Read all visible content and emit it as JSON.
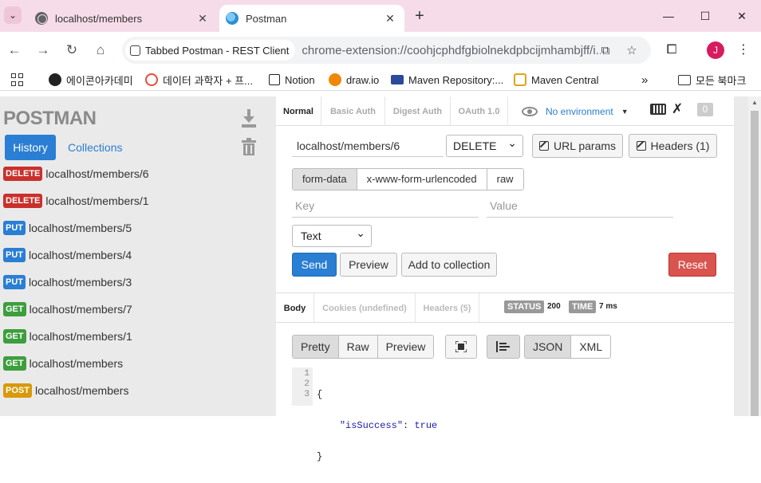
{
  "browser": {
    "tabs": [
      {
        "title": "localhost/members",
        "active": false
      },
      {
        "title": "Postman",
        "active": true
      }
    ],
    "site_chip": "Tabbed Postman - REST Client",
    "url": "chrome-extension://coohjcphdfgbiolnekdpbcijmhambjff/i...",
    "avatar_letter": "J",
    "bookmarks": [
      {
        "label": "에이콘아카데미",
        "icon": "acorn-icon"
      },
      {
        "label": "데이터 과학자 + 프...",
        "icon": "data-icon"
      },
      {
        "label": "Notion",
        "icon": "notion-icon"
      },
      {
        "label": "draw.io",
        "icon": "drawio-icon"
      },
      {
        "label": "Maven Repository:...",
        "icon": "maven-icon"
      },
      {
        "label": "Maven Central",
        "icon": "maven-central-icon"
      }
    ],
    "all_bookmarks": "모든 북마크"
  },
  "sidebar": {
    "logo": "POSTMAN",
    "tabs": {
      "history": "History",
      "collections": "Collections"
    },
    "history": [
      {
        "method": "DELETE",
        "url": "localhost/members/6"
      },
      {
        "method": "DELETE",
        "url": "localhost/members/1"
      },
      {
        "method": "PUT",
        "url": "localhost/members/5"
      },
      {
        "method": "PUT",
        "url": "localhost/members/4"
      },
      {
        "method": "PUT",
        "url": "localhost/members/3"
      },
      {
        "method": "GET",
        "url": "localhost/members/7"
      },
      {
        "method": "GET",
        "url": "localhost/members/1"
      },
      {
        "method": "GET",
        "url": "localhost/members"
      },
      {
        "method": "POST",
        "url": "localhost/members"
      }
    ]
  },
  "main": {
    "auth_tabs": [
      "Normal",
      "Basic Auth",
      "Digest Auth",
      "OAuth 1.0"
    ],
    "environment": "No environment",
    "badge": "0",
    "request_url": "localhost/members/6",
    "method": "DELETE",
    "url_params": "URL params",
    "headers": "Headers (1)",
    "body_types": [
      "form-data",
      "x-www-form-urlencoded",
      "raw"
    ],
    "key_placeholder": "Key",
    "value_placeholder": "Value",
    "text_type": "Text",
    "send": "Send",
    "preview": "Preview",
    "add_to_collection": "Add to collection",
    "reset": "Reset",
    "response_tabs": [
      "Body",
      "Cookies (undefined)",
      "Headers (5)"
    ],
    "status_label": "STATUS",
    "status_value": "200",
    "time_label": "TIME",
    "time_value": "7 ms",
    "view_modes": [
      "Pretty",
      "Raw",
      "Preview"
    ],
    "formats": [
      "JSON",
      "XML"
    ],
    "code": {
      "line_numbers": [
        "1",
        "2",
        "3"
      ],
      "open": "{",
      "key": "\"isSuccess\"",
      "colon": ": ",
      "value": "true",
      "close": "}"
    }
  }
}
